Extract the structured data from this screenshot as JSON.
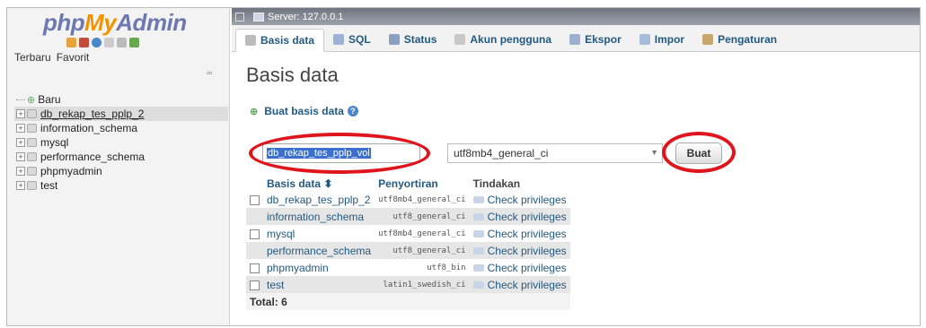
{
  "logo": {
    "php": "php",
    "my": "My",
    "admin": "Admin"
  },
  "nav": {
    "tabs": [
      "Terbaru",
      "Favorit"
    ],
    "collapse": "∞",
    "items": [
      {
        "label": "Baru",
        "type": "new"
      },
      {
        "label": "db_rekap_tes_pplp_2",
        "type": "db",
        "selected": true
      },
      {
        "label": "information_schema",
        "type": "db"
      },
      {
        "label": "mysql",
        "type": "db"
      },
      {
        "label": "performance_schema",
        "type": "db"
      },
      {
        "label": "phpmyadmin",
        "type": "db"
      },
      {
        "label": "test",
        "type": "db"
      }
    ]
  },
  "topbar": {
    "server": "Server: 127.0.0.1"
  },
  "tabs": [
    {
      "label": "Basis data",
      "icon": "database-icon",
      "active": true
    },
    {
      "label": "SQL",
      "icon": "sql-icon"
    },
    {
      "label": "Status",
      "icon": "status-icon"
    },
    {
      "label": "Akun pengguna",
      "icon": "users-icon"
    },
    {
      "label": "Ekspor",
      "icon": "export-icon"
    },
    {
      "label": "Impor",
      "icon": "import-icon"
    },
    {
      "label": "Pengaturan",
      "icon": "settings-icon"
    }
  ],
  "page": {
    "title": "Basis data",
    "create_heading": "Buat basis data",
    "db_name_value": "db_rekap_tes_pplp_vol",
    "collation_value": "utf8mb4_general_ci",
    "create_button": "Buat"
  },
  "table": {
    "headers": {
      "name": "Basis data",
      "sort_arrow": "⬍",
      "collation": "Penyortiran",
      "action": "Tindakan"
    },
    "rows": [
      {
        "name": "db_rekap_tes_pplp_2",
        "collation": "utf8mb4_general_ci",
        "action": "Check privileges"
      },
      {
        "name": "information_schema",
        "collation": "utf8_general_ci",
        "action": "Check privileges"
      },
      {
        "name": "mysql",
        "collation": "utf8mb4_general_ci",
        "action": "Check privileges"
      },
      {
        "name": "performance_schema",
        "collation": "utf8_general_ci",
        "action": "Check privileges"
      },
      {
        "name": "phpmyadmin",
        "collation": "utf8_bin",
        "action": "Check privileges"
      },
      {
        "name": "test",
        "collation": "latin1_swedish_ci",
        "action": "Check privileges"
      }
    ],
    "total": "Total: 6"
  },
  "colors": {
    "link": "#235a81",
    "highlight_ring": "#e0141c",
    "selection": "#3b6fcf"
  }
}
